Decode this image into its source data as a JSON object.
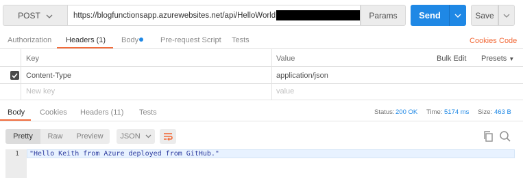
{
  "request": {
    "method": "POST",
    "url": "https://blogfunctionsapp.azurewebsites.net/api/HelloWorld",
    "params_label": "Params",
    "send_label": "Send",
    "save_label": "Save"
  },
  "request_tabs": [
    {
      "label": "Authorization"
    },
    {
      "label": "Headers (1)"
    },
    {
      "label": "Body"
    },
    {
      "label": "Pre-request Script"
    },
    {
      "label": "Tests"
    }
  ],
  "request_links": {
    "cookies": "Cookies",
    "code": "Code"
  },
  "headers_table": {
    "col_key": "Key",
    "col_value": "Value",
    "bulk_edit": "Bulk Edit",
    "presets": "Presets",
    "rows": [
      {
        "key": "Content-Type",
        "value": "application/json",
        "checked": true
      }
    ],
    "new_key_placeholder": "New key",
    "new_value_placeholder": "value"
  },
  "response_tabs": [
    {
      "label": "Body"
    },
    {
      "label": "Cookies"
    },
    {
      "label": "Headers (11)"
    },
    {
      "label": "Tests"
    }
  ],
  "status": {
    "status_label": "Status:",
    "status_value": "200 OK",
    "time_label": "Time:",
    "time_value": "5174 ms",
    "size_label": "Size:",
    "size_value": "463 B"
  },
  "format": {
    "pretty": "Pretty",
    "raw": "Raw",
    "preview": "Preview",
    "type": "JSON"
  },
  "response_body": {
    "line_number": "1",
    "text": "\"Hello Keith from Azure deployed from GitHub.\""
  },
  "colors": {
    "accent": "#f26b3a",
    "primary": "#1f88e5"
  }
}
